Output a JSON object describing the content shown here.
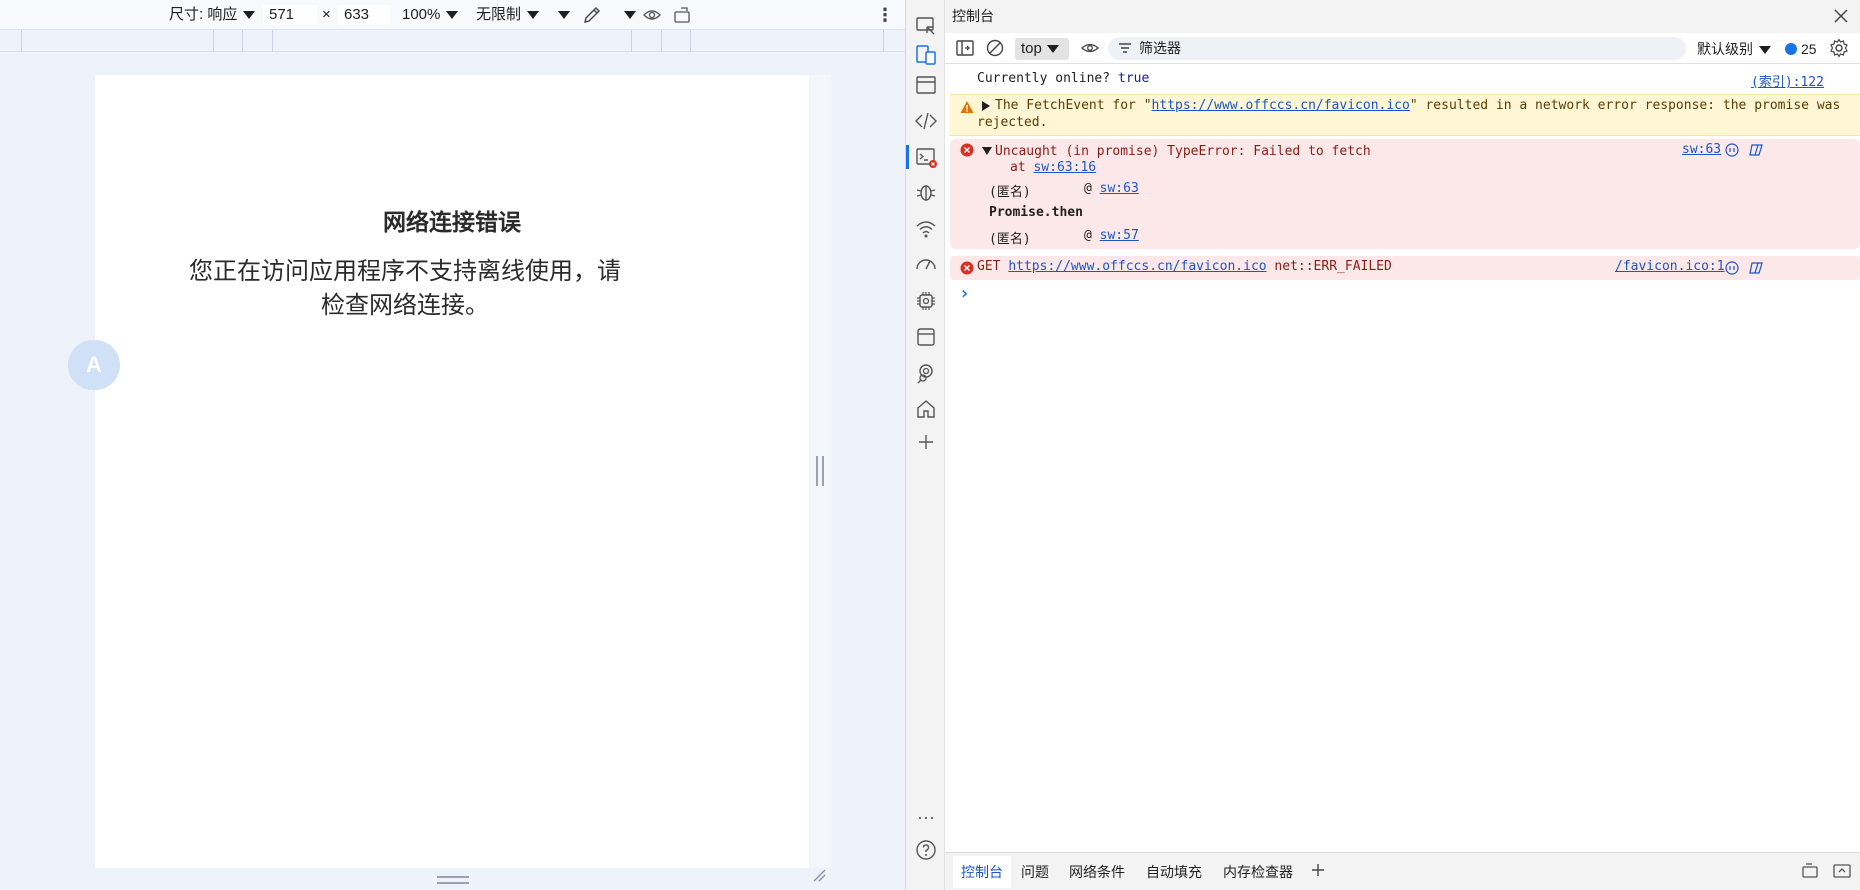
{
  "device_toolbar": {
    "dimensions_label": "尺寸: 响应",
    "width_value": "571",
    "times_sign": "×",
    "height_value": "633",
    "zoom": "100%",
    "throttle": "无限制"
  },
  "page": {
    "heading": "网络连接错误",
    "message": "您正在访问应用程序不支持离线使用，请检查网络连接。",
    "translate_bubble": "A"
  },
  "devtools": {
    "title": "控制台",
    "context": "top",
    "filter_placeholder": "筛选器",
    "log_level": "默认级别",
    "issues_count": "25"
  },
  "console": {
    "online_label": "Currently online?",
    "online_value": "true",
    "online_source": "(索引):122",
    "warn_prefix": "The FetchEvent for \"",
    "warn_url": "https://www.offccs.cn/favicon.ico",
    "warn_suffix": "\" resulted in a network error response: the promise was",
    "warn_line2": "rejected.",
    "err1_text": "Uncaught (in promise) TypeError: Failed to fetch",
    "err1_at": "at",
    "err1_at_link": "sw:63:16",
    "err1_source": "sw:63",
    "stack1_name": "(匿名)",
    "stack_at": "@",
    "stack1_link": "sw:63",
    "stack_promise": "Promise.then",
    "stack2_name": "(匿名)",
    "stack2_link": "sw:57",
    "err2_method": "GET",
    "err2_url": "https://www.offccs.cn/favicon.ico",
    "err2_error": "net::ERR_FAILED",
    "err2_source": "/favicon.ico:1",
    "prompt": "›"
  },
  "drawer": {
    "tabs": [
      "控制台",
      "问题",
      "网络条件",
      "自动填充",
      "内存检查器"
    ]
  },
  "colors": {
    "accent": "#1a73e8",
    "warning_bg": "#fef6d5",
    "error_bg": "#fce8e8",
    "error_icon": "#d93025",
    "warning_icon": "#e37400",
    "link": "#1a56c8"
  }
}
